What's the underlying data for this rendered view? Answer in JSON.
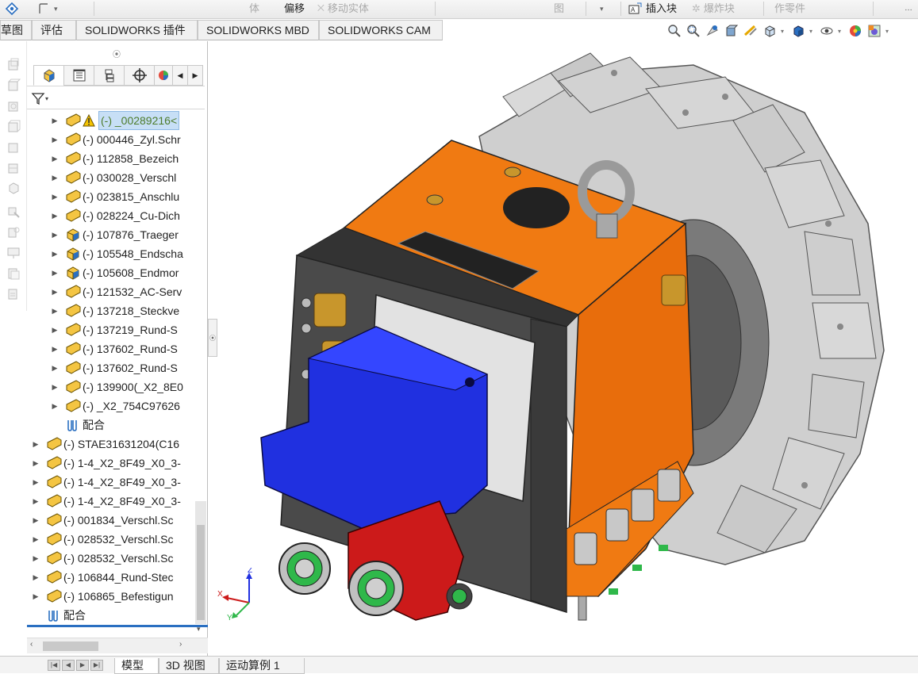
{
  "top_toolbar": {
    "items": [
      {
        "label": "体",
        "dim": true
      },
      {
        "label": "偏移",
        "dim": false
      },
      {
        "label": "移动实体",
        "dim": true
      },
      {
        "label": "图",
        "dim": true
      },
      {
        "label": "插入块",
        "dim": false
      },
      {
        "label": "爆炸块",
        "dim": true
      },
      {
        "label": "作零件",
        "dim": true
      }
    ]
  },
  "command_tabs": [
    "草图",
    "评估",
    "SOLIDWORKS 插件",
    "SOLIDWORKS MBD",
    "SOLIDWORKS CAM"
  ],
  "tree": {
    "selected_item": {
      "label": "(-) _00289216<",
      "warning": true
    },
    "sub_items": [
      {
        "label": "(-) 000446_Zyl.Schr",
        "icon": "assembly-icon"
      },
      {
        "label": "(-) 112858_Bezeich",
        "icon": "assembly-icon"
      },
      {
        "label": "(-) 030028_Verschl",
        "icon": "assembly-icon"
      },
      {
        "label": "(-) 023815_Anschlu",
        "icon": "assembly-icon"
      },
      {
        "label": "(-) 028224_Cu-Dich",
        "icon": "assembly-icon"
      },
      {
        "label": "(-) 107876_Traeger",
        "icon": "part-icon"
      },
      {
        "label": "(-) 105548_Endscha",
        "icon": "part-icon"
      },
      {
        "label": "(-) 105608_Endmor",
        "icon": "part-icon"
      },
      {
        "label": "(-) 121532_AC-Serv",
        "icon": "assembly-icon"
      },
      {
        "label": "(-) 137218_Steckve",
        "icon": "assembly-icon"
      },
      {
        "label": "(-) 137219_Rund-S",
        "icon": "assembly-icon"
      },
      {
        "label": "(-) 137602_Rund-S",
        "icon": "assembly-icon"
      },
      {
        "label": "(-) 137602_Rund-S",
        "icon": "assembly-icon"
      },
      {
        "label": "(-) 139900(_X2_8E0",
        "icon": "assembly-icon"
      },
      {
        "label": "(-) _X2_754C97626",
        "icon": "assembly-icon"
      }
    ],
    "sub_mates_label": "配合",
    "top_items": [
      {
        "label": "(-) STAE31631204(C16"
      },
      {
        "label": "(-) 1-4_X2_8F49_X0_3-"
      },
      {
        "label": "(-) 1-4_X2_8F49_X0_3-"
      },
      {
        "label": "(-) 1-4_X2_8F49_X0_3-"
      },
      {
        "label": "(-) 001834_Verschl.Sc"
      },
      {
        "label": "(-) 028532_Verschl.Sc"
      },
      {
        "label": "(-) 028532_Verschl.Sc"
      },
      {
        "label": "(-) 106844_Rund-Stec"
      },
      {
        "label": "(-) 106865_Befestigun"
      }
    ],
    "mates_label": "配合"
  },
  "bottom_tabs": [
    {
      "label": "模型",
      "active": true
    },
    {
      "label": "3D 视图",
      "active": false
    },
    {
      "label": "运动算例 1",
      "active": false
    }
  ],
  "triad": {
    "x": "X",
    "y": "Y",
    "z": "Z"
  },
  "colors": {
    "orange": "#f07a12",
    "dark_gray": "#4a4a4a",
    "light_gray": "#cfcfcf",
    "blue_part": "#2030e0",
    "red_part": "#cc1a1a",
    "green_part": "#2fb84a",
    "brass": "#c8962c",
    "selection": "#c7dff6"
  }
}
